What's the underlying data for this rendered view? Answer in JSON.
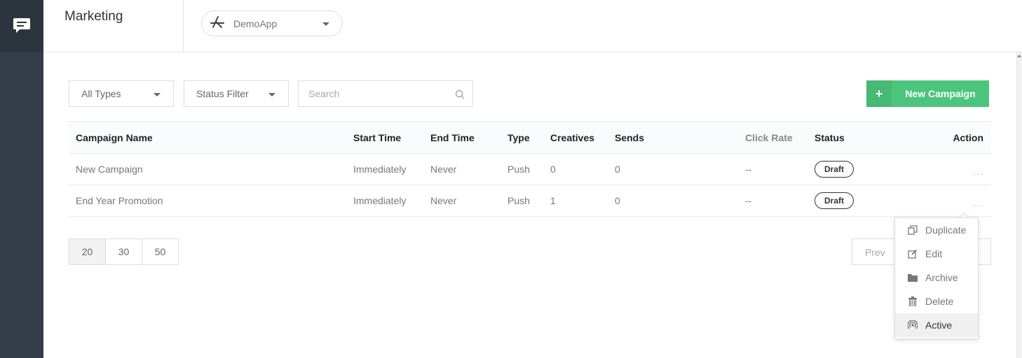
{
  "header": {
    "title": "Marketing",
    "app_name": "DemoApp"
  },
  "filters": {
    "types": "All Types",
    "status": "Status Filter",
    "search_placeholder": "Search"
  },
  "actions": {
    "new_campaign": "New Campaign",
    "plus": "+"
  },
  "table": {
    "columns": [
      "Campaign Name",
      "Start Time",
      "End Time",
      "Type",
      "Creatives",
      "Sends",
      "Click Rate",
      "Status",
      "Action"
    ],
    "rows": [
      {
        "name": "New Campaign",
        "start": "Immediately",
        "end": "Never",
        "type": "Push",
        "creatives": "0",
        "sends": "0",
        "click_rate": "--",
        "status": "Draft",
        "action": "..."
      },
      {
        "name": "End Year Promotion",
        "start": "Immediately",
        "end": "Never",
        "type": "Push",
        "creatives": "1",
        "sends": "0",
        "click_rate": "--",
        "status": "Draft",
        "action": "..."
      }
    ]
  },
  "pager": {
    "sizes": [
      "20",
      "30",
      "50"
    ],
    "selected": "20",
    "prev": "Prev"
  },
  "context_menu": {
    "items": [
      {
        "label": "Duplicate",
        "icon": "duplicate-icon"
      },
      {
        "label": "Edit",
        "icon": "edit-icon"
      },
      {
        "label": "Archive",
        "icon": "folder-icon"
      },
      {
        "label": "Delete",
        "icon": "trash-icon"
      },
      {
        "label": "Active",
        "icon": "broadcast-icon"
      }
    ],
    "highlighted": "Active"
  },
  "colors": {
    "sidebar": "#343e48",
    "accent_green": "#4cc57c"
  }
}
